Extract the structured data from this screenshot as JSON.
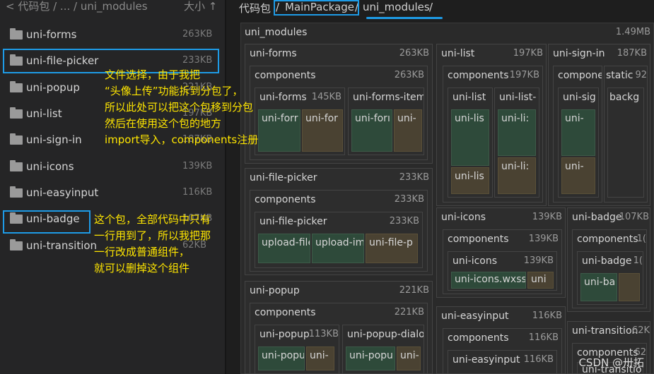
{
  "sidebar": {
    "breadcrumb": "< 代码包 / ... / uni_modules",
    "size_header": "大小 ↑",
    "items": [
      {
        "name": "uni-forms",
        "size": "263KB"
      },
      {
        "name": "uni-file-picker",
        "size": "233KB"
      },
      {
        "name": "uni-popup",
        "size": "221KB"
      },
      {
        "name": "uni-list",
        "size": "197KB"
      },
      {
        "name": "uni-sign-in",
        "size": "187KB"
      },
      {
        "name": "uni-icons",
        "size": "139KB"
      },
      {
        "name": "uni-easyinput",
        "size": "116KB"
      },
      {
        "name": "uni-badge",
        "size": "107KB"
      },
      {
        "name": "uni-transition",
        "size": "62KB"
      }
    ]
  },
  "breadcrumb": {
    "root": "代码包",
    "sep1": "/",
    "package": "MainPackage",
    "sep2": "/",
    "folder": "uni_modules",
    "sep3": "/"
  },
  "treemap": {
    "root_label": "uni_modules",
    "root_size": "1.49MB",
    "forms": {
      "label": "uni-forms",
      "size": "263KB",
      "comp": "components",
      "comp_size": "263KB",
      "sub1": "uni-forms",
      "sub1_size": "145KB",
      "sub2": "uni-forms-item",
      "leaf1": "uni-forr",
      "leaf2": "uni-for",
      "leaf3": "uni-forı",
      "leaf4": "uni-"
    },
    "list": {
      "label": "uni-list",
      "size": "197KB",
      "comp": "components",
      "comp_size": "197KB",
      "sub1": "uni-list",
      "sub1_size": "1(",
      "sub2": "uni-list-",
      "leaf1": "uni-lis",
      "leaf2": "uni-lis",
      "leaf3": "uni-li:",
      "leaf4": "uni-li:"
    },
    "signin": {
      "label": "uni-sign-in",
      "size": "187KB",
      "comp": "compone",
      "static": "static",
      "static_size": "92",
      "sub1": "uni-sig",
      "sub2": "backg",
      "leaf1": "uni-",
      "leaf2": "uni-"
    },
    "picker": {
      "label": "uni-file-picker",
      "size": "233KB",
      "comp": "components",
      "comp_size": "233KB",
      "sub1": "uni-file-picker",
      "sub1_size": "233KB",
      "leaf1": "upload-file",
      "leaf2": "upload-im",
      "leaf3": "uni-file-p"
    },
    "icons": {
      "label": "uni-icons",
      "size": "139KB",
      "comp": "components",
      "comp_size": "139KB",
      "sub1": "uni-icons",
      "sub1_size": "139KB",
      "leaf1": "uni-icons.wxss",
      "leaf2": "uni"
    },
    "badge": {
      "label": "uni-badge",
      "size": "107KB",
      "comp": "components",
      "comp_size": "1(",
      "sub1": "uni-badge",
      "sub1_size": "1(",
      "leaf1": "uni-ba",
      "leaf2": ""
    },
    "popup": {
      "label": "uni-popup",
      "size": "221KB",
      "comp": "components",
      "comp_size": "221KB",
      "sub1": "uni-popup",
      "sub1_size": "113KB",
      "sub2": "uni-popup-dialo",
      "leaf1": "uni-popu",
      "leaf2": "uni-",
      "leaf3": "uni-popu",
      "leaf4": "uni-"
    },
    "easyinput": {
      "label": "uni-easyinput",
      "size": "116KB",
      "comp": "components",
      "comp_size": "116KB",
      "sub1": "uni-easyinput",
      "sub1_size": "116KB"
    },
    "transition": {
      "label": "uni-transition",
      "size": "62K",
      "comp": "components",
      "comp_size": "62",
      "sub1": "uni-transitio"
    }
  },
  "annotations": {
    "note1": [
      "文件选择，由于我把",
      "“头像上传”功能拆到分包了，",
      "所以此处可以把这个包移到分包",
      "然后在使用这个包的地方",
      "import导入，components注册"
    ],
    "note2": [
      "这个包，全部代码中只有",
      "一行用到了，所以我把那",
      "一行改成普通组件，",
      "就可以删掉这个组件"
    ]
  },
  "watermark": "CSDN @卅拓",
  "colors": {
    "highlight": "#1e9be6",
    "annotation": "#ffe600",
    "leaf_green": "#2e4a3a",
    "leaf_brown": "#4a4232"
  }
}
